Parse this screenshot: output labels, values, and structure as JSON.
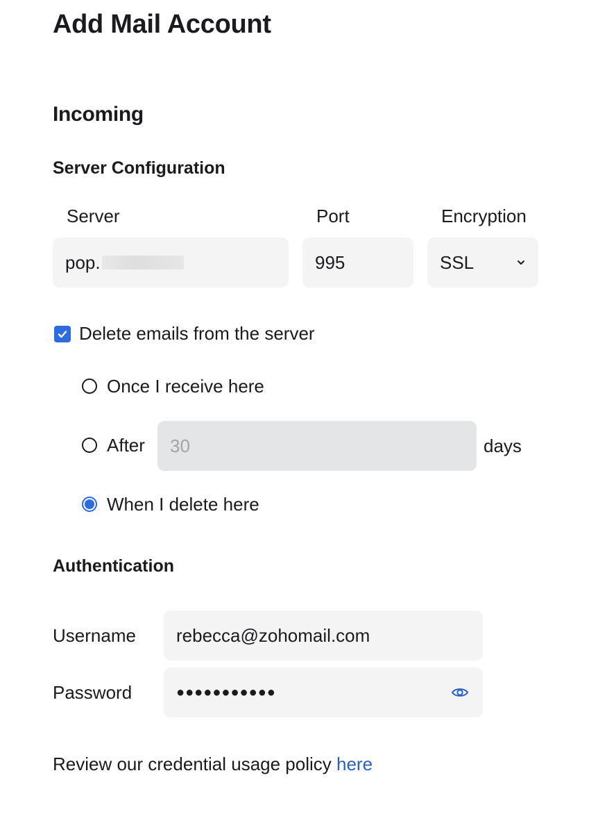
{
  "page": {
    "title": "Add Mail Account"
  },
  "incoming": {
    "heading": "Incoming",
    "server_config": {
      "heading": "Server Configuration",
      "server_label": "Server",
      "server_value": "pop.",
      "port_label": "Port",
      "port_value": "995",
      "encryption_label": "Encryption",
      "encryption_value": "SSL"
    },
    "delete_option": {
      "checkbox_label": "Delete emails from the server",
      "checked": true,
      "radios": [
        {
          "label": "Once I receive here",
          "selected": false
        },
        {
          "label": "After",
          "selected": false
        },
        {
          "label": "When I delete here",
          "selected": true
        }
      ],
      "after_days_placeholder": "30",
      "days_suffix": "days"
    }
  },
  "authentication": {
    "heading": "Authentication",
    "username_label": "Username",
    "username_value": "rebecca@zohomail.com",
    "password_label": "Password",
    "password_masked": "●●●●●●●●●●●",
    "show_password_icon": "eye-icon"
  },
  "footer": {
    "policy_text": "Review our credential usage policy ",
    "policy_link": "here"
  },
  "colors": {
    "accent": "#2c6ce0",
    "link": "#2a5fc8",
    "field_bg": "#f4f4f4",
    "disabled_field_bg": "#e4e5e7"
  }
}
